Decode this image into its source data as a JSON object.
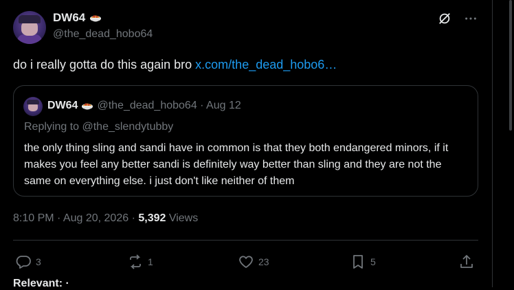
{
  "post": {
    "author": {
      "display_name": "DW64",
      "handle": "@the_dead_hobo64"
    },
    "text": "do i really gotta do this again bro ",
    "link_text": "x.com/the_dead_hobo6…",
    "quote": {
      "display_name": "DW64",
      "handle_and_date": "@the_dead_hobo64 · Aug 12",
      "replying_to": "Replying to @the_slendytubby",
      "text": "the only thing sling and sandi have in common is that they both endangered minors, if it makes you feel any better sandi is definitely way better than sling and they are not the same on everything else. i just don't like neither of them"
    },
    "timestamp": "8:10 PM · Aug 20, 2026 · ",
    "views_count": "5,392",
    "views_label": " Views",
    "actions": {
      "replies": "3",
      "reposts": "1",
      "likes": "23",
      "bookmarks": "5"
    },
    "relevant_label": "Relevant: ·"
  },
  "icons": {
    "emoji": "spaghetti-bowl-icon",
    "grok": "grok-icon",
    "more": "more-icon",
    "reply": "reply-icon",
    "repost": "repost-icon",
    "like": "heart-icon",
    "bookmark": "bookmark-icon",
    "share": "share-icon"
  },
  "colors": {
    "background": "#000000",
    "text": "#e7e9ea",
    "muted": "#71767b",
    "link": "#1d9bf0",
    "border": "#2f3336"
  }
}
